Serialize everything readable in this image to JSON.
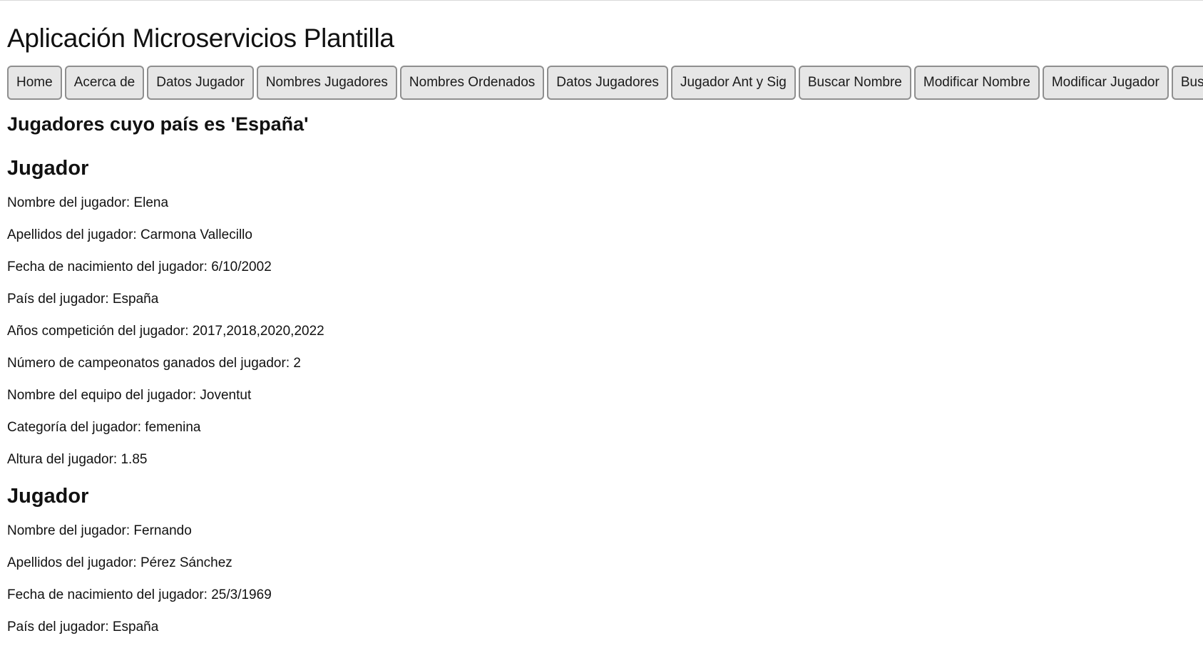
{
  "header": {
    "title": "Aplicación Microservicios Plantilla"
  },
  "nav": {
    "items": [
      "Home",
      "Acerca de",
      "Datos Jugador",
      "Nombres Jugadores",
      "Nombres Ordenados",
      "Datos Jugadores",
      "Jugador Ant y Sig",
      "Buscar Nombre",
      "Modificar Nombre",
      "Modificar Jugador",
      "Buscar"
    ]
  },
  "main": {
    "section_title": "Jugadores cuyo país es 'España'",
    "players": [
      {
        "heading": "Jugador",
        "fields": [
          "Nombre del jugador: Elena",
          "Apellidos del jugador: Carmona Vallecillo",
          "Fecha de nacimiento del jugador: 6/10/2002",
          "País del jugador: España",
          "Años competición del jugador: 2017,2018,2020,2022",
          "Número de campeonatos ganados del jugador: 2",
          "Nombre del equipo del jugador: Joventut",
          "Categoría del jugador: femenina",
          "Altura del jugador: 1.85"
        ]
      },
      {
        "heading": "Jugador",
        "fields": [
          "Nombre del jugador: Fernando",
          "Apellidos del jugador: Pérez Sánchez",
          "Fecha de nacimiento del jugador: 25/3/1969",
          "País del jugador: España"
        ]
      }
    ]
  }
}
